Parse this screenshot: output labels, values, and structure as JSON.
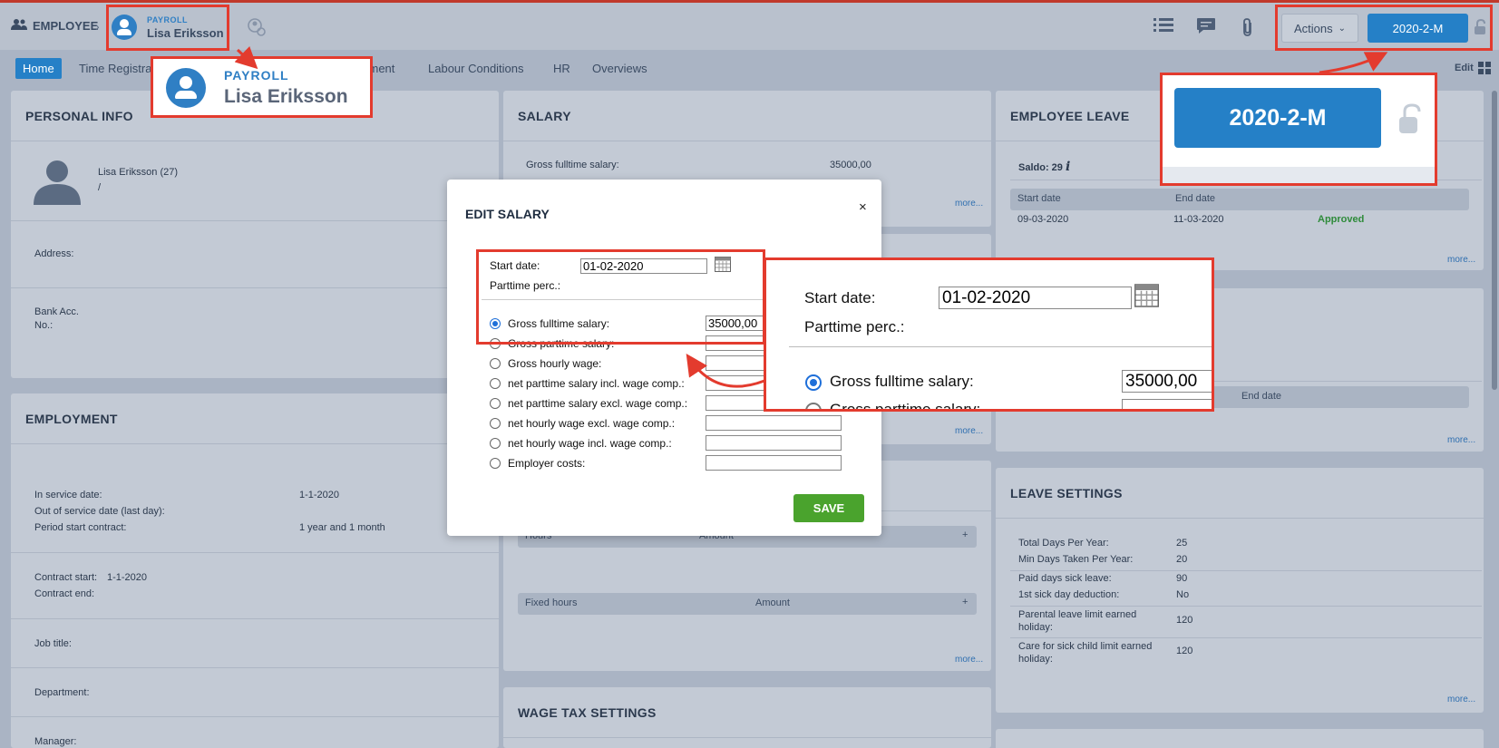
{
  "header": {
    "breadcrumb_label": "EMPLOYEE",
    "payroll_label": "PAYROLL",
    "employee_name": "Lisa Eriksson",
    "actions_label": "Actions",
    "period_label": "2020-2-M"
  },
  "tabs": [
    "Home",
    "Time Registra",
    "yment",
    "Labour Conditions",
    "HR",
    "Overviews"
  ],
  "edit_label": "Edit",
  "personal_info": {
    "title": "PERSONAL INFO",
    "name_age": "Lisa Eriksson (27)",
    "slash": "/",
    "address_label": "Address:",
    "bank_label": "Bank Acc.",
    "bank_label2": "No.:"
  },
  "employment": {
    "title": "EMPLOYMENT",
    "in_service_label": "In service date:",
    "in_service_value": "1-1-2020",
    "out_service_label": "Out of service date (last day):",
    "period_label": "Period start contract:",
    "period_value": "1 year and 1 month",
    "contract_start_label": "Contract start:",
    "contract_start_value": "1-1-2020",
    "contract_end_label": "Contract end:",
    "job_title_label": "Job title:",
    "department_label": "Department:",
    "manager_label": "Manager:"
  },
  "salary": {
    "title": "SALARY",
    "gross_label": "Gross fulltime salary:",
    "gross_value": "35000,00",
    "more": "more..."
  },
  "hours_table": {
    "hours_col": "Hours",
    "amount_col": "Amount",
    "fixed_col": "Fixed hours",
    "fixed_amount_col": "Amount",
    "plus": "+"
  },
  "wage_tax": {
    "title": "WAGE TAX SETTINGS"
  },
  "employee_leave": {
    "title": "EMPLOYEE LEAVE",
    "saldo": "Saldo: 29",
    "start_col": "Start date",
    "end_col": "End date",
    "row_start": "09-03-2020",
    "row_end": "11-03-2020",
    "row_status": "Approved",
    "end_date_col2": "End date",
    "more": "more..."
  },
  "leave_settings": {
    "title": "LEAVE SETTINGS",
    "rows": [
      {
        "label": "Total Days Per Year:",
        "value": "25"
      },
      {
        "label": "Min Days Taken Per Year:",
        "value": "20"
      },
      {
        "label": "Paid days sick leave:",
        "value": "90"
      },
      {
        "label": "1st sick day deduction:",
        "value": "No"
      },
      {
        "label": "Parental leave limit earned holiday:",
        "value": "120"
      },
      {
        "label": "Care for sick child limit earned holiday:",
        "value": "120"
      }
    ],
    "more": "more..."
  },
  "modal": {
    "title": "EDIT SALARY",
    "close": "×",
    "start_date_label": "Start date:",
    "start_date_value": "01-02-2020",
    "parttime_label": "Parttime perc.:",
    "options": [
      {
        "label": "Gross fulltime salary:",
        "value": "35000,00",
        "selected": true
      },
      {
        "label": "Gross parttime salary:",
        "value": "",
        "selected": false
      },
      {
        "label": "Gross hourly wage:",
        "value": "",
        "selected": false
      },
      {
        "label": "net parttime salary incl. wage comp.:",
        "value": "",
        "selected": false
      },
      {
        "label": "net parttime salary excl. wage comp.:",
        "value": "",
        "selected": false
      },
      {
        "label": "net hourly wage excl. wage comp.:",
        "value": "",
        "selected": false
      },
      {
        "label": "net hourly wage incl. wage comp.:",
        "value": "",
        "selected": false
      },
      {
        "label": "Employer costs:",
        "value": "",
        "selected": false
      }
    ],
    "save_label": "SAVE"
  },
  "zoom_callouts": {
    "payroll_label": "PAYROLL",
    "employee_name": "Lisa Eriksson",
    "period_label": "2020-2-M",
    "start_date_label": "Start date:",
    "start_date_value": "01-02-2020",
    "parttime_label": "Parttime perc.:",
    "gross_label": "Gross fulltime salary:",
    "gross_value": "35000,00",
    "gross_parttime_label": "Gross parttime salary:"
  },
  "colors": {
    "accent": "#2580c7",
    "highlight": "#e33b2e",
    "save": "#4aa32d",
    "approved": "#2e8b3a"
  }
}
